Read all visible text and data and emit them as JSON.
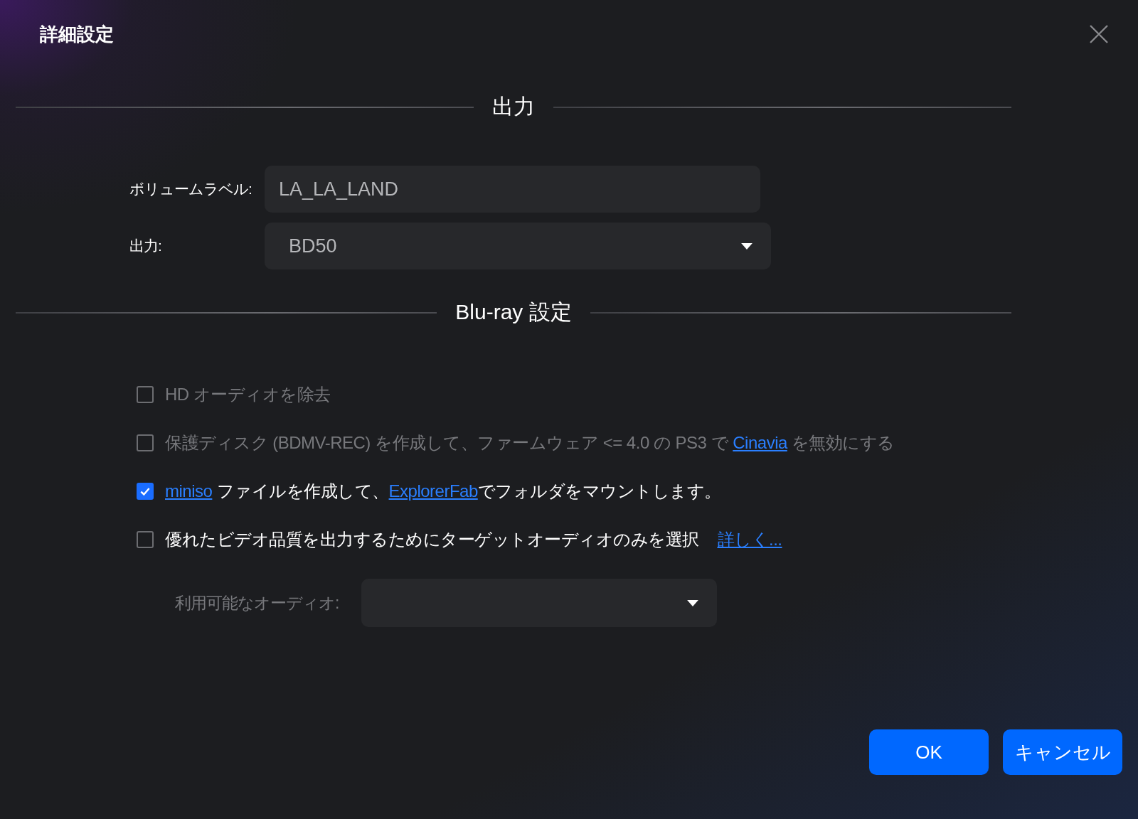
{
  "dialog": {
    "title": "詳細設定"
  },
  "sections": [
    {
      "heading": "出力",
      "fields": [
        {
          "kind": "text",
          "label": "ボリュームラベル:",
          "value": "LA_LA_LAND"
        },
        {
          "kind": "dropdown",
          "label": "出力:",
          "value": "BD50"
        }
      ]
    },
    {
      "heading": "Blu-ray 設定",
      "options": [
        {
          "checked": false,
          "disabled": true,
          "parts": [
            {
              "text": "HD オーディオを除去"
            }
          ]
        },
        {
          "checked": false,
          "disabled": true,
          "parts": [
            {
              "text": "保護ディスク (BDMV-REC) を作成して、ファームウェア <= 4.0 の PS3 で "
            },
            {
              "text": "Cinavia",
              "link": true
            },
            {
              "text": " を無効にする"
            }
          ]
        },
        {
          "checked": true,
          "disabled": false,
          "parts": [
            {
              "text": "miniso",
              "link": true
            },
            {
              "text": " ファイルを作成して、"
            },
            {
              "text": "ExplorerFab",
              "link": true
            },
            {
              "text": "でフォルダをマウントします。"
            }
          ]
        },
        {
          "checked": false,
          "disabled": false,
          "parts": [
            {
              "text": "優れたビデオ品質を出力するためにターゲットオーディオのみを選択"
            }
          ],
          "more_link": "詳しく..."
        }
      ],
      "audio": {
        "label": "利用可能なオーディオ:",
        "disabled": true
      }
    }
  ],
  "buttons": [
    {
      "label": "OK"
    },
    {
      "label": "キャンセル"
    }
  ]
}
